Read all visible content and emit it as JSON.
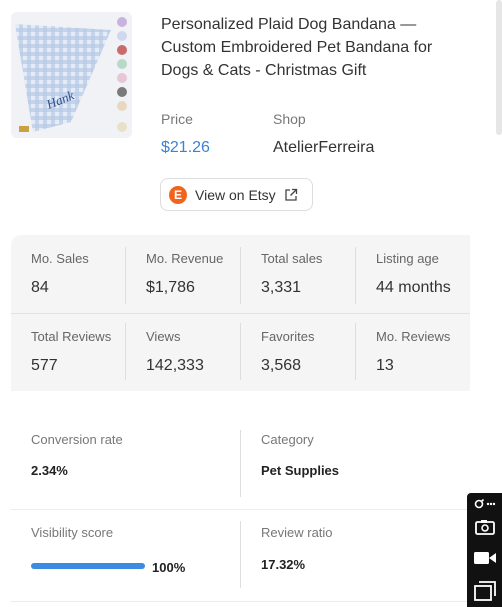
{
  "product": {
    "title": "Personalized Plaid Dog Bandana — Custom Embroidered Pet Bandana for Dogs & Cats - Christmas Gift",
    "thumbnail_icon": "plaid-bandana-photo",
    "thumbnail_text": "Hank",
    "price_label": "Price",
    "price_value": "$21.26",
    "shop_label": "Shop",
    "shop_value": "AtelierFerreira",
    "etsy_logo_letter": "E",
    "etsy_button_label": "View on Etsy",
    "colors": {
      "price": "#3b82d6",
      "etsy": "#f1641e"
    }
  },
  "stats": {
    "row1": [
      {
        "label": "Mo. Sales",
        "value": "84"
      },
      {
        "label": "Mo. Revenue",
        "value": "$1,786"
      },
      {
        "label": "Total sales",
        "value": "3,331"
      },
      {
        "label": "Listing age",
        "value": "44 months"
      }
    ],
    "row2": [
      {
        "label": "Total Reviews",
        "value": "577"
      },
      {
        "label": "Views",
        "value": "142,333"
      },
      {
        "label": "Favorites",
        "value": "3,568"
      },
      {
        "label": "Mo. Reviews",
        "value": "13"
      }
    ]
  },
  "metrics": {
    "conversion_rate": {
      "label": "Conversion rate",
      "value": "2.34%"
    },
    "category": {
      "label": "Category",
      "value": "Pet Supplies"
    },
    "visibility_score": {
      "label": "Visibility score",
      "value": "100%",
      "fraction": 1.0
    },
    "review_ratio": {
      "label": "Review ratio",
      "value": "17.32%"
    },
    "progress_color": "#3b8be0"
  },
  "tools": [
    "link-icon",
    "camera-icon",
    "video-icon",
    "window-icon"
  ]
}
